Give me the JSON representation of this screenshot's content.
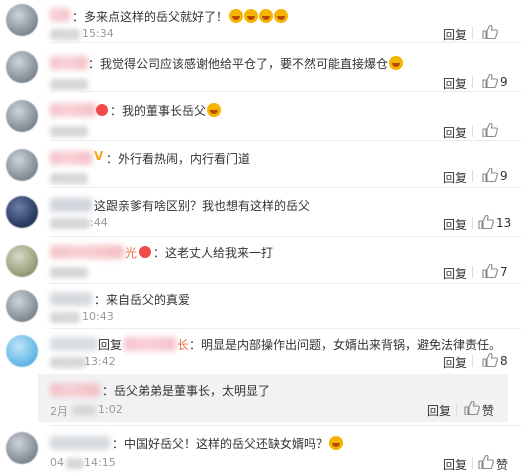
{
  "actions": {
    "reply": "回复",
    "like_icon": "thumb-up-icon"
  },
  "comments": [
    {
      "text": "：多来点这样的岳父就好了！",
      "time": "15:34",
      "likes": "",
      "emoji_count": 4
    },
    {
      "text": "：我觉得公司应该感谢他给平仓了，要不然可能直接爆仓",
      "time": "",
      "likes": "9"
    },
    {
      "text": "：我的董事长岳父",
      "time": "",
      "likes": ""
    },
    {
      "text": "：外行看热闹，内行看门道",
      "time": "",
      "likes": "9"
    },
    {
      "text": "这跟亲爹有啥区别？我也想有这样的岳父",
      "time": ":44",
      "likes": "13"
    },
    {
      "text": "：这老丈人给我来一打",
      "time": "",
      "likes": "7",
      "name_tail": "光"
    },
    {
      "text": "：来自岳父的真爱",
      "time": "10:43",
      "likes": ""
    },
    {
      "text": "：明显是内部操作出问题，女婿出来背锅，避免法律责任。",
      "prefix": "回复",
      "name_tail": "长",
      "time": "13:42",
      "likes": "8"
    },
    {
      "text": "：中国好岳父！这样的岳父还缺女婿吗？",
      "time": "14:15",
      "likes": "",
      "time_prefix": "04"
    }
  ],
  "nested_reply": {
    "text": "：岳父弟弟是董事长，太明显了",
    "time_prefix": "2月",
    "time": "1:02",
    "action": "回复",
    "like_label": "赞"
  },
  "last_like_label": "赞"
}
